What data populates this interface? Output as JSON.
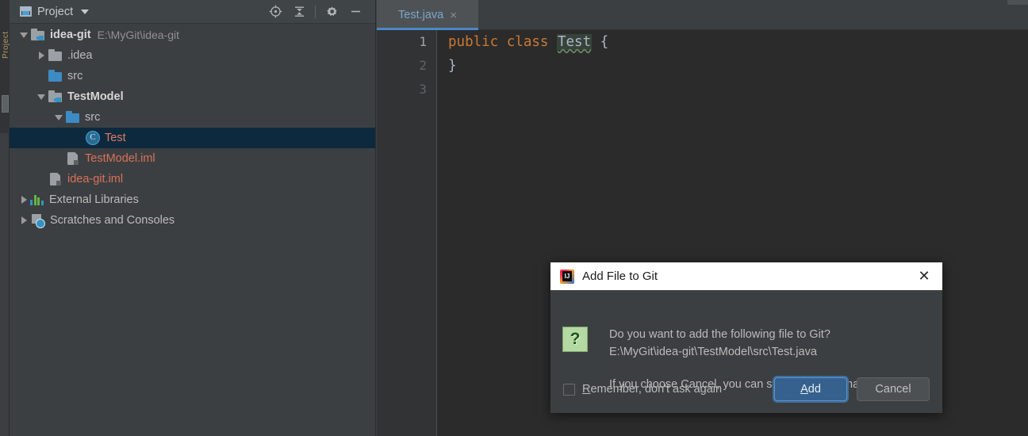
{
  "window": {
    "app": "IntelliJ IDEA"
  },
  "project_panel": {
    "header": {
      "title": "Project",
      "dropdown_caret": "chevron-down-icon",
      "icons": [
        "locate-target-icon",
        "collapse-all-icon",
        "settings-gear-icon",
        "minimize-icon"
      ]
    },
    "tree": [
      {
        "label": "idea-git",
        "path": "E:\\MyGit\\idea-git",
        "icon": "module-icon",
        "expanded": true,
        "indent": 0,
        "style": "bold",
        "selected": false
      },
      {
        "label": ".idea",
        "path": "",
        "icon": "folder-grey-icon",
        "expanded": false,
        "indent": 1,
        "style": "normal",
        "selected": false
      },
      {
        "label": "src",
        "path": "",
        "icon": "folder-blue-icon",
        "expanded": null,
        "indent": 1,
        "style": "normal",
        "selected": false
      },
      {
        "label": "TestModel",
        "path": "",
        "icon": "module-icon",
        "expanded": true,
        "indent": 1,
        "style": "bold",
        "selected": false
      },
      {
        "label": "src",
        "path": "",
        "icon": "folder-blue-icon",
        "expanded": true,
        "indent": 2,
        "style": "normal",
        "selected": false
      },
      {
        "label": "Test",
        "path": "",
        "icon": "java-class-icon",
        "expanded": null,
        "indent": 3,
        "style": "vcs-red",
        "selected": true
      },
      {
        "label": "TestModel.iml",
        "path": "",
        "icon": "iml-file-icon",
        "expanded": null,
        "indent": 2,
        "style": "vcs-red",
        "selected": false
      },
      {
        "label": "idea-git.iml",
        "path": "",
        "icon": "iml-file-icon",
        "expanded": null,
        "indent": 1,
        "style": "vcs-red",
        "selected": false
      },
      {
        "label": "External Libraries",
        "path": "",
        "icon": "libraries-icon",
        "expanded": false,
        "indent": 0,
        "style": "normal",
        "selected": false
      },
      {
        "label": "Scratches and Consoles",
        "path": "",
        "icon": "scratches-icon",
        "expanded": false,
        "indent": 0,
        "style": "normal",
        "selected": false
      }
    ]
  },
  "editor": {
    "tabs": [
      {
        "label": "Test.java",
        "close": "×",
        "active": true
      }
    ],
    "line_numbers": [
      "1",
      "2",
      "3"
    ],
    "code_lines": [
      {
        "parts": [
          {
            "text": "public class ",
            "token": "keyword"
          },
          {
            "text": "Test",
            "token": "class-name-warning"
          },
          {
            "text": " {",
            "token": "punctuation"
          }
        ]
      },
      {
        "parts": [
          {
            "text": "}",
            "token": "punctuation"
          }
        ]
      },
      {
        "parts": []
      }
    ],
    "code_line1_keyword": "public class ",
    "code_line1_class": "Test",
    "code_line1_brace": " {",
    "code_line2": "}"
  },
  "dialog": {
    "title": "Add File to Git",
    "logo": "intellij-idea-logo",
    "close": "✕",
    "icon": "question-mark-icon",
    "question_glyph": "?",
    "message_line1": "Do you want to add the following file to Git?",
    "message_line2": "E:\\MyGit\\idea-git\\TestModel\\src\\Test.java",
    "message_line3": "If you choose Cancel, you can still add it later manually.",
    "checkbox": {
      "checked": false,
      "mnemonic": "R",
      "label_rest": "emember, don't ask again"
    },
    "buttons": {
      "primary_mnemonic": "A",
      "primary_rest": "dd",
      "default_label": "Cancel"
    }
  },
  "colors": {
    "panel_bg": "#3c3f41",
    "editor_bg": "#2b2b2b",
    "selection_bg": "#0d293e",
    "accent_blue": "#4a88c7",
    "vcs_added_red": "#d9715b",
    "keyword_orange": "#cc7832",
    "primary_button": "#36618e"
  }
}
